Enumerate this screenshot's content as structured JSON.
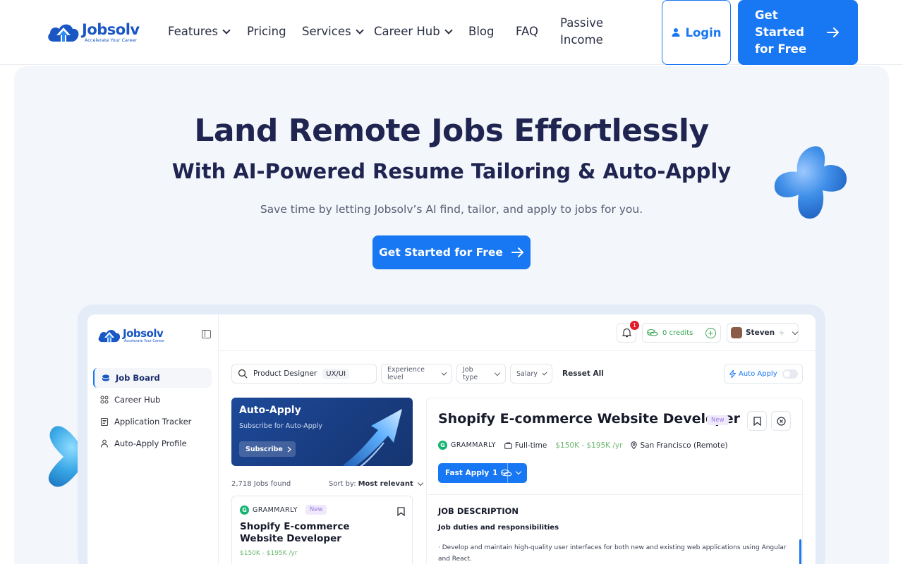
{
  "brand": {
    "name": "Jobsolv",
    "tagline": "Accelerate Your Career",
    "accent": "#1877f2"
  },
  "nav": {
    "items": [
      {
        "label": "Features",
        "has_dropdown": true
      },
      {
        "label": "Pricing",
        "has_dropdown": false
      },
      {
        "label": "Services",
        "has_dropdown": true
      },
      {
        "label": "Career Hub",
        "has_dropdown": true
      },
      {
        "label": "Blog",
        "has_dropdown": false
      },
      {
        "label": "FAQ",
        "has_dropdown": false
      }
    ],
    "passive_income": "Passive Income",
    "login": "Login",
    "get_started": "Get Started for Free"
  },
  "hero": {
    "title": "Land Remote Jobs Effortlessly",
    "subtitle": "With AI-Powered Resume Tailoring & Auto-Apply",
    "description": "Save time by letting Jobsolv’s AI find, tailor, and apply to jobs for you.",
    "cta": "Get Started for Free"
  },
  "app": {
    "brand": "Jobsolv",
    "tagline": "Accelerate Your Career",
    "sidebar": [
      {
        "label": "Job Board",
        "icon": "stack-icon",
        "active": true
      },
      {
        "label": "Career Hub",
        "icon": "grid-icon",
        "active": false
      },
      {
        "label": "Application Tracker",
        "icon": "clipboard-icon",
        "active": false
      },
      {
        "label": "Auto-Apply Profile",
        "icon": "user-icon",
        "active": false
      }
    ],
    "topbar": {
      "notifications": "1",
      "credits": "0 credits",
      "user": "Steven"
    },
    "filters": {
      "search": "Product Designer",
      "search_tag": "UX/UI",
      "experience": "Experience level",
      "job_type": "Job type",
      "salary": "Salary",
      "reset": "Resset All",
      "auto_apply": "Auto Apply"
    },
    "promo": {
      "title": "Auto-Apply",
      "subtitle": "Subscribe for Auto-Apply",
      "button": "Subscribe"
    },
    "list": {
      "count": "2,718 Jobs found",
      "sort_label": "Sort by:",
      "sort_value": "Most relevant",
      "card": {
        "company": "GRAMMARLY",
        "badge": "New",
        "title": "Shopify E-commerce Website Developer",
        "salary": "$150K - $195K /yr"
      }
    },
    "detail": {
      "title": "Shopify E-commerce Website Developer",
      "badge": "New",
      "company": "GRAMMARLY",
      "type": "Full-time",
      "salary": "$150K - $195K /yr",
      "location": "San Francisco (Remote)",
      "fast_apply": "Fast Apply",
      "fast_apply_cost": "1",
      "section_title": "JOB DESCRIPTION",
      "subsection": "Job duties and responsibilities",
      "body": "· Develop and maintain high-quality user interfaces for both new and existing web applications using Angular and React."
    }
  }
}
